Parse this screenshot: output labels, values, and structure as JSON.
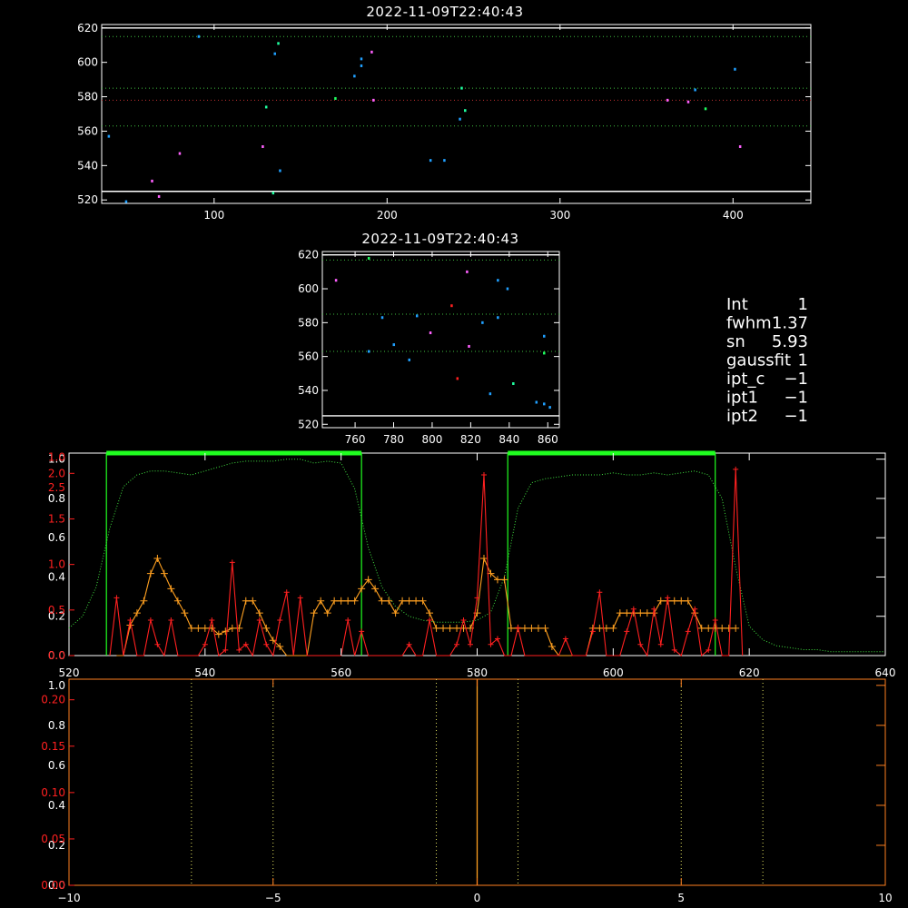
{
  "chart_data": [
    {
      "id": "top",
      "type": "scatter",
      "title": "2022-11-09T22:40:43",
      "xlim": [
        35,
        445
      ],
      "ylim": [
        518,
        622
      ],
      "xticks": [
        100,
        200,
        300,
        400
      ],
      "yticks": [
        520,
        540,
        560,
        580,
        600,
        620
      ],
      "hlines": [
        {
          "y": 620,
          "color": "#ffffff",
          "style": "solid"
        },
        {
          "y": 615,
          "color": "#40c040",
          "style": "dot"
        },
        {
          "y": 585,
          "color": "#40c040",
          "style": "dot"
        },
        {
          "y": 578,
          "color": "#c03030",
          "style": "dot"
        },
        {
          "y": 563,
          "color": "#40c040",
          "style": "dot"
        },
        {
          "y": 525,
          "color": "#ffffff",
          "style": "solid"
        }
      ],
      "points": [
        [
          39,
          557,
          "#20a0ff"
        ],
        [
          49,
          519,
          "#20a0ff"
        ],
        [
          64,
          531,
          "#ff60ff"
        ],
        [
          68,
          522,
          "#ff60ff"
        ],
        [
          80,
          547,
          "#ff60ff"
        ],
        [
          91,
          615,
          "#20a0ff"
        ],
        [
          128,
          551,
          "#ff60ff"
        ],
        [
          130,
          574,
          "#20ffa0"
        ],
        [
          134,
          524,
          "#20ffa0"
        ],
        [
          135,
          605,
          "#20a0ff"
        ],
        [
          137,
          611,
          "#20ffa0"
        ],
        [
          138,
          537,
          "#20a0ff"
        ],
        [
          170,
          579,
          "#20ff60"
        ],
        [
          181,
          592,
          "#20a0ff"
        ],
        [
          185,
          602,
          "#20a0ff"
        ],
        [
          185,
          598,
          "#20a0ff"
        ],
        [
          191,
          606,
          "#ff60ff"
        ],
        [
          192,
          578,
          "#ff60ff"
        ],
        [
          225,
          543,
          "#20a0ff"
        ],
        [
          233,
          543,
          "#20a0ff"
        ],
        [
          242,
          567,
          "#20a0ff"
        ],
        [
          243,
          585,
          "#20ffa0"
        ],
        [
          245,
          572,
          "#20ffa0"
        ],
        [
          362,
          578,
          "#ff60ff"
        ],
        [
          374,
          577,
          "#ff60ff"
        ],
        [
          378,
          584,
          "#20a0ff"
        ],
        [
          384,
          573,
          "#20ff60"
        ],
        [
          401,
          596,
          "#20a0ff"
        ],
        [
          404,
          551,
          "#ff60ff"
        ]
      ]
    },
    {
      "id": "middle",
      "type": "scatter",
      "title": "2022-11-09T22:40:43",
      "xlim": [
        743,
        866
      ],
      "ylim": [
        518,
        622
      ],
      "xticks": [
        760,
        780,
        800,
        820,
        840,
        860
      ],
      "yticks": [
        520,
        540,
        560,
        580,
        600,
        620
      ],
      "hlines": [
        {
          "y": 620,
          "color": "#ffffff",
          "style": "solid"
        },
        {
          "y": 617,
          "color": "#40c040",
          "style": "dot"
        },
        {
          "y": 585,
          "color": "#40c040",
          "style": "dot"
        },
        {
          "y": 563,
          "color": "#40c040",
          "style": "dot"
        },
        {
          "y": 525,
          "color": "#ffffff",
          "style": "solid"
        }
      ],
      "points": [
        [
          750,
          605,
          "#ff60ff"
        ],
        [
          767,
          618,
          "#20ff60"
        ],
        [
          767,
          563,
          "#20a0ff"
        ],
        [
          774,
          583,
          "#20a0ff"
        ],
        [
          780,
          567,
          "#20a0ff"
        ],
        [
          788,
          558,
          "#20a0ff"
        ],
        [
          792,
          584,
          "#20a0ff"
        ],
        [
          799,
          574,
          "#ff60ff"
        ],
        [
          810,
          590,
          "#ff2020"
        ],
        [
          813,
          547,
          "#ff2020"
        ],
        [
          818,
          610,
          "#ff60ff"
        ],
        [
          819,
          566,
          "#ff60ff"
        ],
        [
          826,
          580,
          "#20a0ff"
        ],
        [
          830,
          538,
          "#20a0ff"
        ],
        [
          834,
          605,
          "#20a0ff"
        ],
        [
          834,
          583,
          "#20a0ff"
        ],
        [
          839,
          600,
          "#20a0ff"
        ],
        [
          842,
          544,
          "#20ffa0"
        ],
        [
          854,
          533,
          "#20a0ff"
        ],
        [
          858,
          572,
          "#20a0ff"
        ],
        [
          858,
          562,
          "#20ff60"
        ],
        [
          858,
          532,
          "#20a0ff"
        ],
        [
          861,
          530,
          "#20a0ff"
        ]
      ]
    },
    {
      "id": "spectrum",
      "type": "line",
      "xlim": [
        520,
        640
      ],
      "xticks": [
        520,
        540,
        560,
        580,
        600,
        620,
        640
      ],
      "ylim": [
        0,
        1.0
      ],
      "left_ticks_white": [
        {
          "v": 0.0,
          "label": "0.0"
        },
        {
          "v": 0.2,
          "label": "0.2"
        },
        {
          "v": 0.4,
          "label": "0.4"
        },
        {
          "v": 0.6,
          "label": "0.6"
        },
        {
          "v": 0.8,
          "label": "0.8"
        },
        {
          "v": 1.0,
          "label": "1.0"
        }
      ],
      "left_ticks_red": [
        {
          "v": 0.0,
          "label": "0.0"
        },
        {
          "v": 0.25,
          "label": "0.5"
        },
        {
          "v": 0.5,
          "label": "1.0"
        },
        {
          "v": 0.75,
          "label": "1.5"
        },
        {
          "v": 1.0,
          "label": "2.0"
        }
      ],
      "left_ticks_red_top": [
        {
          "v": 0.98,
          "label": "1.0"
        },
        {
          "v": 0.83,
          "label": "2.5"
        }
      ],
      "green_bands": [
        [
          525.5,
          563
        ],
        [
          584.5,
          615
        ]
      ],
      "green_dotted_x": [
        520,
        522,
        524,
        526,
        528,
        530,
        532,
        534,
        536,
        538,
        540,
        542,
        544,
        546,
        548,
        550,
        552,
        554,
        556,
        558,
        560,
        562,
        564,
        566,
        568,
        570,
        572,
        574,
        576,
        578,
        580,
        582,
        584,
        586,
        588,
        590,
        592,
        594,
        596,
        598,
        600,
        602,
        604,
        606,
        608,
        610,
        612,
        614,
        616,
        618,
        620,
        622,
        624,
        626,
        628,
        630,
        632,
        634,
        636,
        638,
        640
      ],
      "green_dotted_y": [
        0.14,
        0.2,
        0.35,
        0.65,
        0.86,
        0.92,
        0.94,
        0.94,
        0.93,
        0.92,
        0.94,
        0.96,
        0.98,
        0.99,
        0.99,
        0.99,
        1.0,
        1.0,
        0.98,
        0.99,
        0.98,
        0.85,
        0.55,
        0.35,
        0.25,
        0.2,
        0.18,
        0.17,
        0.17,
        0.17,
        0.18,
        0.22,
        0.4,
        0.75,
        0.88,
        0.9,
        0.91,
        0.92,
        0.92,
        0.92,
        0.93,
        0.92,
        0.92,
        0.93,
        0.92,
        0.93,
        0.94,
        0.92,
        0.8,
        0.45,
        0.15,
        0.08,
        0.05,
        0.04,
        0.03,
        0.03,
        0.02,
        0.02,
        0.02,
        0.02,
        0.02
      ],
      "orange_x": [
        527,
        528,
        529,
        530,
        531,
        532,
        533,
        534,
        535,
        536,
        537,
        538,
        539,
        540,
        541,
        542,
        543,
        544,
        545,
        546,
        547,
        548,
        549,
        550,
        551,
        552,
        553,
        554,
        555,
        556,
        557,
        558,
        559,
        560,
        561,
        562,
        563,
        564,
        565,
        566,
        567,
        568,
        569,
        570,
        571,
        572,
        573,
        574,
        575,
        576,
        577,
        578,
        579,
        580,
        581,
        582,
        583,
        584,
        585,
        586,
        587,
        588,
        589,
        590,
        591,
        592,
        593,
        594,
        595,
        596,
        597,
        598,
        599,
        600,
        601,
        602,
        603,
        604,
        605,
        606,
        607,
        608,
        609,
        610,
        611,
        612,
        613,
        614,
        615,
        616,
        617,
        618
      ],
      "orange_y": [
        0,
        0,
        0.1,
        0.14,
        0.18,
        0.27,
        0.32,
        0.27,
        0.22,
        0.18,
        0.14,
        0.09,
        0.09,
        0.09,
        0.09,
        0.07,
        0.08,
        0.09,
        0.09,
        0.18,
        0.18,
        0.14,
        0.09,
        0.05,
        0.03,
        0,
        0,
        0,
        0,
        0.14,
        0.18,
        0.14,
        0.18,
        0.18,
        0.18,
        0.18,
        0.22,
        0.25,
        0.22,
        0.18,
        0.18,
        0.14,
        0.18,
        0.18,
        0.18,
        0.18,
        0.14,
        0.09,
        0.09,
        0.09,
        0.09,
        0.09,
        0.09,
        0.14,
        0.32,
        0.27,
        0.25,
        0.25,
        0.09,
        0.09,
        0.09,
        0.09,
        0.09,
        0.09,
        0.03,
        0,
        0,
        0,
        0,
        0,
        0.09,
        0.09,
        0.09,
        0.09,
        0.14,
        0.14,
        0.14,
        0.14,
        0.14,
        0.14,
        0.18,
        0.18,
        0.18,
        0.18,
        0.18,
        0.14,
        0.09,
        0.09,
        0.09,
        0.09,
        0.09,
        0.09
      ],
      "red_x": [
        526,
        527,
        528,
        529,
        530,
        531,
        532,
        533,
        534,
        535,
        536,
        537,
        538,
        539,
        540,
        541,
        542,
        543,
        544,
        545,
        546,
        547,
        548,
        549,
        550,
        551,
        552,
        553,
        554,
        555,
        556,
        557,
        558,
        559,
        560,
        561,
        562,
        563,
        564,
        565,
        566,
        567,
        568,
        569,
        570,
        571,
        572,
        573,
        574,
        575,
        576,
        577,
        578,
        579,
        580,
        581,
        582,
        583,
        584,
        585,
        586,
        587,
        588,
        589,
        590,
        591,
        592,
        593,
        594,
        595,
        596,
        597,
        598,
        599,
        600,
        601,
        602,
        603,
        604,
        605,
        606,
        607,
        608,
        609,
        610,
        611,
        612,
        613,
        614,
        615,
        616,
        617,
        618,
        619
      ],
      "red_y": [
        0,
        0.31,
        0,
        0.19,
        0,
        0,
        0.19,
        0.06,
        0,
        0.19,
        0,
        0,
        0,
        0,
        0.06,
        0.19,
        0,
        0.03,
        0.5,
        0.03,
        0.06,
        0,
        0.19,
        0.06,
        0,
        0.19,
        0.34,
        0,
        0.31,
        0,
        0,
        0,
        0,
        0,
        0,
        0.19,
        0,
        0.13,
        0,
        0,
        0,
        0,
        0,
        0,
        0.06,
        0,
        0,
        0.19,
        0,
        0,
        0,
        0.06,
        0.19,
        0.06,
        0.31,
        0.97,
        0.06,
        0.09,
        0,
        0,
        0.15,
        0,
        0,
        0,
        0,
        0,
        0,
        0.09,
        0,
        0,
        0,
        0.13,
        0.34,
        0,
        0,
        0,
        0.13,
        0.25,
        0.06,
        0,
        0.25,
        0.06,
        0.31,
        0.03,
        0,
        0.13,
        0.25,
        0,
        0.03,
        0.19,
        0,
        0,
        1.0,
        0
      ],
      "red_marker_y_scale": 0.5
    },
    {
      "id": "bottom",
      "type": "line",
      "xlim": [
        -10,
        10
      ],
      "xticks": [
        -10,
        -5,
        0,
        5,
        10
      ],
      "ylim": [
        0,
        1.0
      ],
      "left_ticks_white": [
        {
          "v": 0.0,
          "label": "0.0"
        },
        {
          "v": 0.2,
          "label": "0.2"
        },
        {
          "v": 0.4,
          "label": "0.4"
        },
        {
          "v": 0.6,
          "label": "0.6"
        },
        {
          "v": 0.8,
          "label": "0.8"
        },
        {
          "v": 1.0,
          "label": "1.0"
        }
      ],
      "left_ticks_red": [
        {
          "v": 0.0,
          "label": "0.00"
        },
        {
          "v": 0.25,
          "label": "0.05"
        },
        {
          "v": 0.5,
          "label": "0.10"
        },
        {
          "v": 0.75,
          "label": "0.15"
        },
        {
          "v": 1.0,
          "label": "0.20"
        }
      ],
      "dotted_x": [
        -7,
        -5,
        -1,
        1,
        5,
        7
      ],
      "solid_x": [
        0
      ]
    }
  ],
  "info": [
    {
      "label": "Int",
      "value": "1"
    },
    {
      "label": "fwhm",
      "value": "1.37"
    },
    {
      "label": "sn",
      "value": "5.93"
    },
    {
      "label": "gaussfit",
      "value": "1"
    },
    {
      "label": "ipt_c",
      "value": "−1"
    },
    {
      "label": "ipt1",
      "value": "−1"
    },
    {
      "label": "ipt2",
      "value": "−1"
    }
  ]
}
